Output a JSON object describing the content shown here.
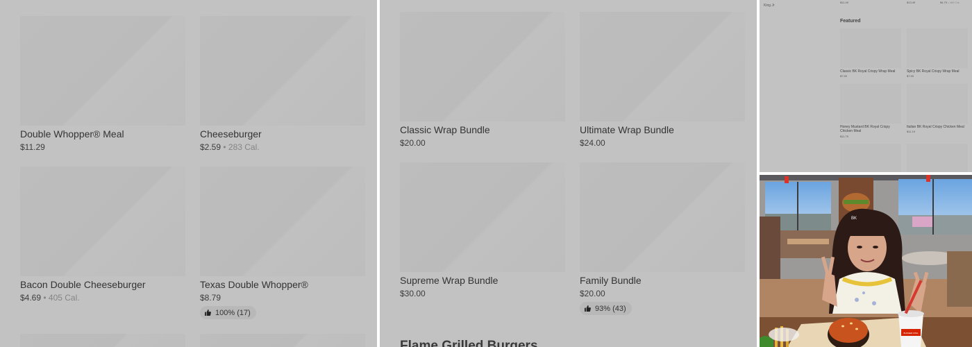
{
  "left_panel": {
    "items": [
      {
        "name": "Double Whopper® Meal",
        "price": "$11.29",
        "calories": ""
      },
      {
        "name": "Cheeseburger",
        "price": "$2.59",
        "calories": " • 283 Cal."
      },
      {
        "name": "Bacon Double Cheeseburger",
        "price": "$4.69",
        "calories": " • 405 Cal."
      },
      {
        "name": "Texas Double Whopper®",
        "price": "$8.79",
        "calories": "",
        "rating": "100% (17)"
      }
    ]
  },
  "middle_panel": {
    "items": [
      {
        "name": "Classic Wrap Bundle",
        "price": "$20.00"
      },
      {
        "name": "Ultimate Wrap Bundle",
        "price": "$24.00"
      },
      {
        "name": "Supreme Wrap Bundle",
        "price": "$30.00"
      },
      {
        "name": "Family Bundle",
        "price": "$20.00",
        "rating": "93% (43)"
      }
    ],
    "section_title": "Flame Grilled Burgers"
  },
  "right_panel": {
    "store_label": "King Jr",
    "top_prices": [
      "$11.49",
      "$13.49",
      "$4.79"
    ],
    "top_price_cal": " • 469 Cal.",
    "featured_title": "Featured",
    "items": [
      {
        "name": "Classic BK Royal Crispy Wrap Meal",
        "price": "$7.59"
      },
      {
        "name": "Spicy BK Royal Crispy Wrap  Meal",
        "price": "$7.59"
      },
      {
        "name": "Honey Mustard BK Royal Crispy Chicken Meal",
        "price": "$11.79"
      },
      {
        "name": "Italian BK Royal Crispy Chicken Meal",
        "price": "$11.19"
      }
    ]
  },
  "photo": {
    "cup_brand": "BURGER KING",
    "wall_brand": "BK"
  },
  "colors": {
    "overlay_gray": "#c2c2c2",
    "brand_red": "#d62300",
    "cup_white": "#f5f5f5"
  },
  "icons": {
    "rating": "thumbs-up-icon"
  }
}
